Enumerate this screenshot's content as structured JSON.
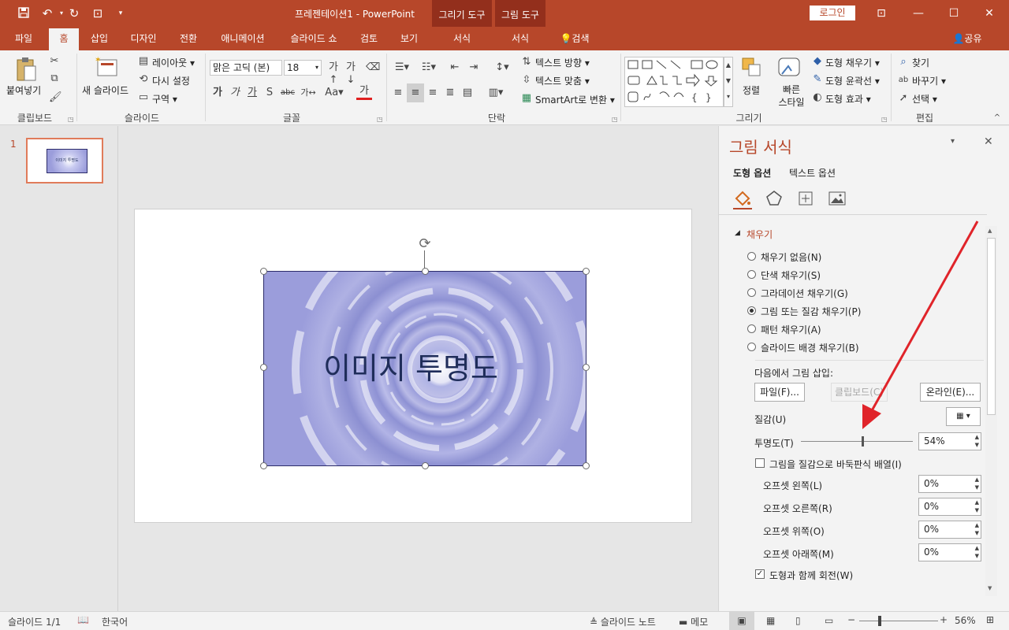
{
  "titlebar": {
    "doc_name": "프레젠테이션1",
    "sep": "-",
    "app_name": "PowerPoint",
    "login": "로그인",
    "ctx1_label": "그리기 도구",
    "ctx2_label": "그림 도구"
  },
  "tabs": [
    "파일",
    "홈",
    "삽입",
    "디자인",
    "전환",
    "애니메이션",
    "슬라이드 쇼",
    "검토",
    "보기",
    "서식",
    "서식"
  ],
  "tell_me": "검색",
  "share": "공유",
  "ribbon": {
    "clipboard": {
      "paste": "붙여넣기",
      "label": "클립보드"
    },
    "slides": {
      "new_slide": "새 슬라이드",
      "layout": "레이아웃",
      "reset": "다시 설정",
      "section": "구역",
      "label": "슬라이드"
    },
    "font": {
      "font_name": "맑은 고딕 (본)",
      "font_size": "18",
      "label": "글꼴"
    },
    "paragraph": {
      "text_dir": "텍스트 방향",
      "align_text": "텍스트 맞춤",
      "smartart": "SmartArt로 변환",
      "label": "단락"
    },
    "drawing": {
      "arrange": "정렬",
      "quick_styles": "빠른 스타일",
      "shape_fill": "도형 채우기",
      "shape_outline": "도형 윤곽선",
      "shape_effects": "도형 효과",
      "label": "그리기"
    },
    "editing": {
      "find": "찾기",
      "replace": "바꾸기",
      "select": "선택",
      "label": "편집"
    }
  },
  "thumbnails": [
    {
      "number": "1",
      "caption": "이미지 투명도"
    }
  ],
  "slide": {
    "title": "이미지 투명도"
  },
  "pane": {
    "title": "그림 서식",
    "tab_shape": "도형 옵션",
    "tab_text": "텍스트 옵션",
    "section_fill": "채우기",
    "fill_options": [
      {
        "label": "채우기 없음(N)",
        "checked": false
      },
      {
        "label": "단색 채우기(S)",
        "checked": false
      },
      {
        "label": "그라데이션 채우기(G)",
        "checked": false
      },
      {
        "label": "그림 또는 질감 채우기(P)",
        "checked": true
      },
      {
        "label": "패턴 채우기(A)",
        "checked": false
      },
      {
        "label": "슬라이드 배경 채우기(B)",
        "checked": false
      }
    ],
    "insert_from": "다음에서 그림 삽입:",
    "btn_file": "파일(F)...",
    "btn_clipboard": "클립보드(C)",
    "btn_online": "온라인(E)...",
    "texture_label": "질감(U)",
    "transparency_label": "투명도(T)",
    "transparency_value": "54%",
    "transparency_fraction": 0.54,
    "tile_label": "그림을 질감으로 바둑판식 배열(I)",
    "tile_checked": false,
    "offsets": [
      {
        "label": "오프셋 왼쪽(L)",
        "value": "0%"
      },
      {
        "label": "오프셋 오른쪽(R)",
        "value": "0%"
      },
      {
        "label": "오프셋 위쪽(O)",
        "value": "0%"
      },
      {
        "label": "오프셋 아래쪽(M)",
        "value": "0%"
      }
    ],
    "rotate_label": "도형과 함께 회전(W)",
    "rotate_checked": true
  },
  "status": {
    "slide_info": "슬라이드 1/1",
    "language": "한국어",
    "notes": "슬라이드 노트",
    "comments": "메모",
    "zoom": "56%"
  },
  "colors": {
    "accent": "#b7472a",
    "arrow": "#e0242a",
    "context": "#932f1c"
  }
}
